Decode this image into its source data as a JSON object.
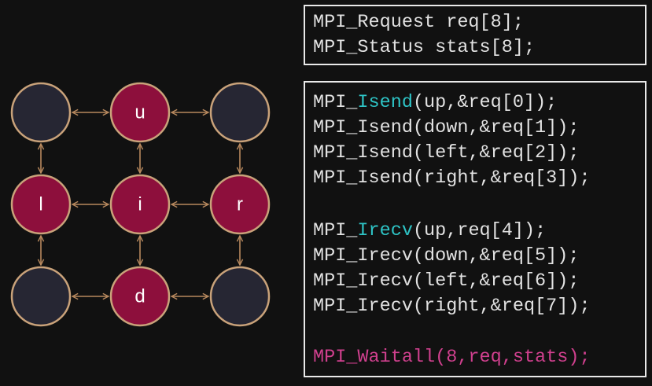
{
  "diagram": {
    "colors": {
      "active_node_fill": "#8d0f3c",
      "inactive_node_fill": "#262633",
      "node_border": "#c9a27a",
      "arrow": "#b8895e"
    },
    "nodes": [
      {
        "id": "tl",
        "label": "",
        "active": false
      },
      {
        "id": "up",
        "label": "u",
        "active": true
      },
      {
        "id": "tr",
        "label": "",
        "active": false
      },
      {
        "id": "left",
        "label": "l",
        "active": true
      },
      {
        "id": "center",
        "label": "i",
        "active": true
      },
      {
        "id": "right",
        "label": "r",
        "active": true
      },
      {
        "id": "bl",
        "label": "",
        "active": false
      },
      {
        "id": "down",
        "label": "d",
        "active": true
      },
      {
        "id": "br",
        "label": "",
        "active": false
      }
    ],
    "edges": [
      [
        "tl",
        "up"
      ],
      [
        "up",
        "tr"
      ],
      [
        "left",
        "center"
      ],
      [
        "center",
        "right"
      ],
      [
        "bl",
        "down"
      ],
      [
        "down",
        "br"
      ],
      [
        "tl",
        "left"
      ],
      [
        "left",
        "bl"
      ],
      [
        "up",
        "center"
      ],
      [
        "center",
        "down"
      ],
      [
        "tr",
        "right"
      ],
      [
        "right",
        "br"
      ]
    ]
  },
  "code": {
    "colors": {
      "text": "#e2e2e2",
      "highlight_cyan": "#2ec4c6",
      "highlight_magenta": "#d0408e"
    },
    "declarations": [
      "MPI_Request req[8];",
      "MPI_Status stats[8];"
    ],
    "isend": {
      "prefix": "MPI_",
      "keyword": "Isend",
      "first_args": "(up,&req[0]);",
      "lines": [
        "MPI_Isend(down,&req[1]);",
        "MPI_Isend(left,&req[2]);",
        "MPI_Isend(right,&req[3]);"
      ]
    },
    "irecv": {
      "prefix": "MPI_",
      "keyword": "Irecv",
      "first_args": "(up,req[4]);",
      "lines": [
        "MPI_Irecv(down,&req[5]);",
        "MPI_Irecv(left,&req[6]);",
        "MPI_Irecv(right,&req[7]);"
      ]
    },
    "waitall": "MPI_Waitall(8,req,stats);"
  }
}
